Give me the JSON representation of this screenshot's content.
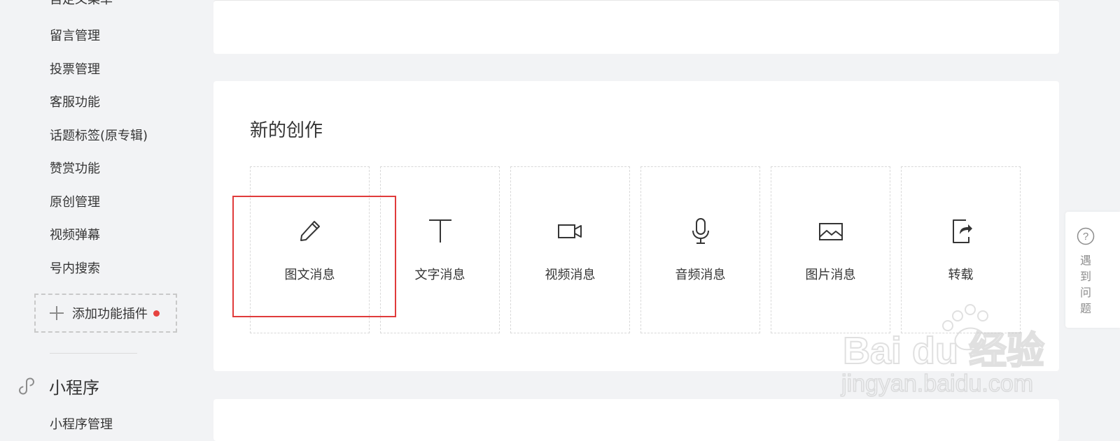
{
  "sidebar": {
    "cut_top_item": "自定义菜单",
    "items": [
      "留言管理",
      "投票管理",
      "客服功能",
      "话题标签(原专辑)",
      "赞赏功能",
      "原创管理",
      "视频弹幕",
      "号内搜索"
    ],
    "add_plugin_label": "添加功能插件",
    "section_title": "小程序",
    "cut_bottom_item": "小程序管理"
  },
  "main": {
    "create_title": "新的创作",
    "tiles": [
      {
        "label": "图文消息",
        "icon": "pencil-icon"
      },
      {
        "label": "文字消息",
        "icon": "text-t-icon"
      },
      {
        "label": "视频消息",
        "icon": "video-camera-icon"
      },
      {
        "label": "音频消息",
        "icon": "microphone-icon"
      },
      {
        "label": "图片消息",
        "icon": "image-icon"
      },
      {
        "label": "转载",
        "icon": "share-icon"
      }
    ]
  },
  "help": {
    "label": "遇到问题"
  },
  "watermark": {
    "brand": "Bai du 经验",
    "url": "jingyan.baidu.com"
  },
  "colors": {
    "highlight": "#e03b3b",
    "notification_dot": "#e64340"
  }
}
